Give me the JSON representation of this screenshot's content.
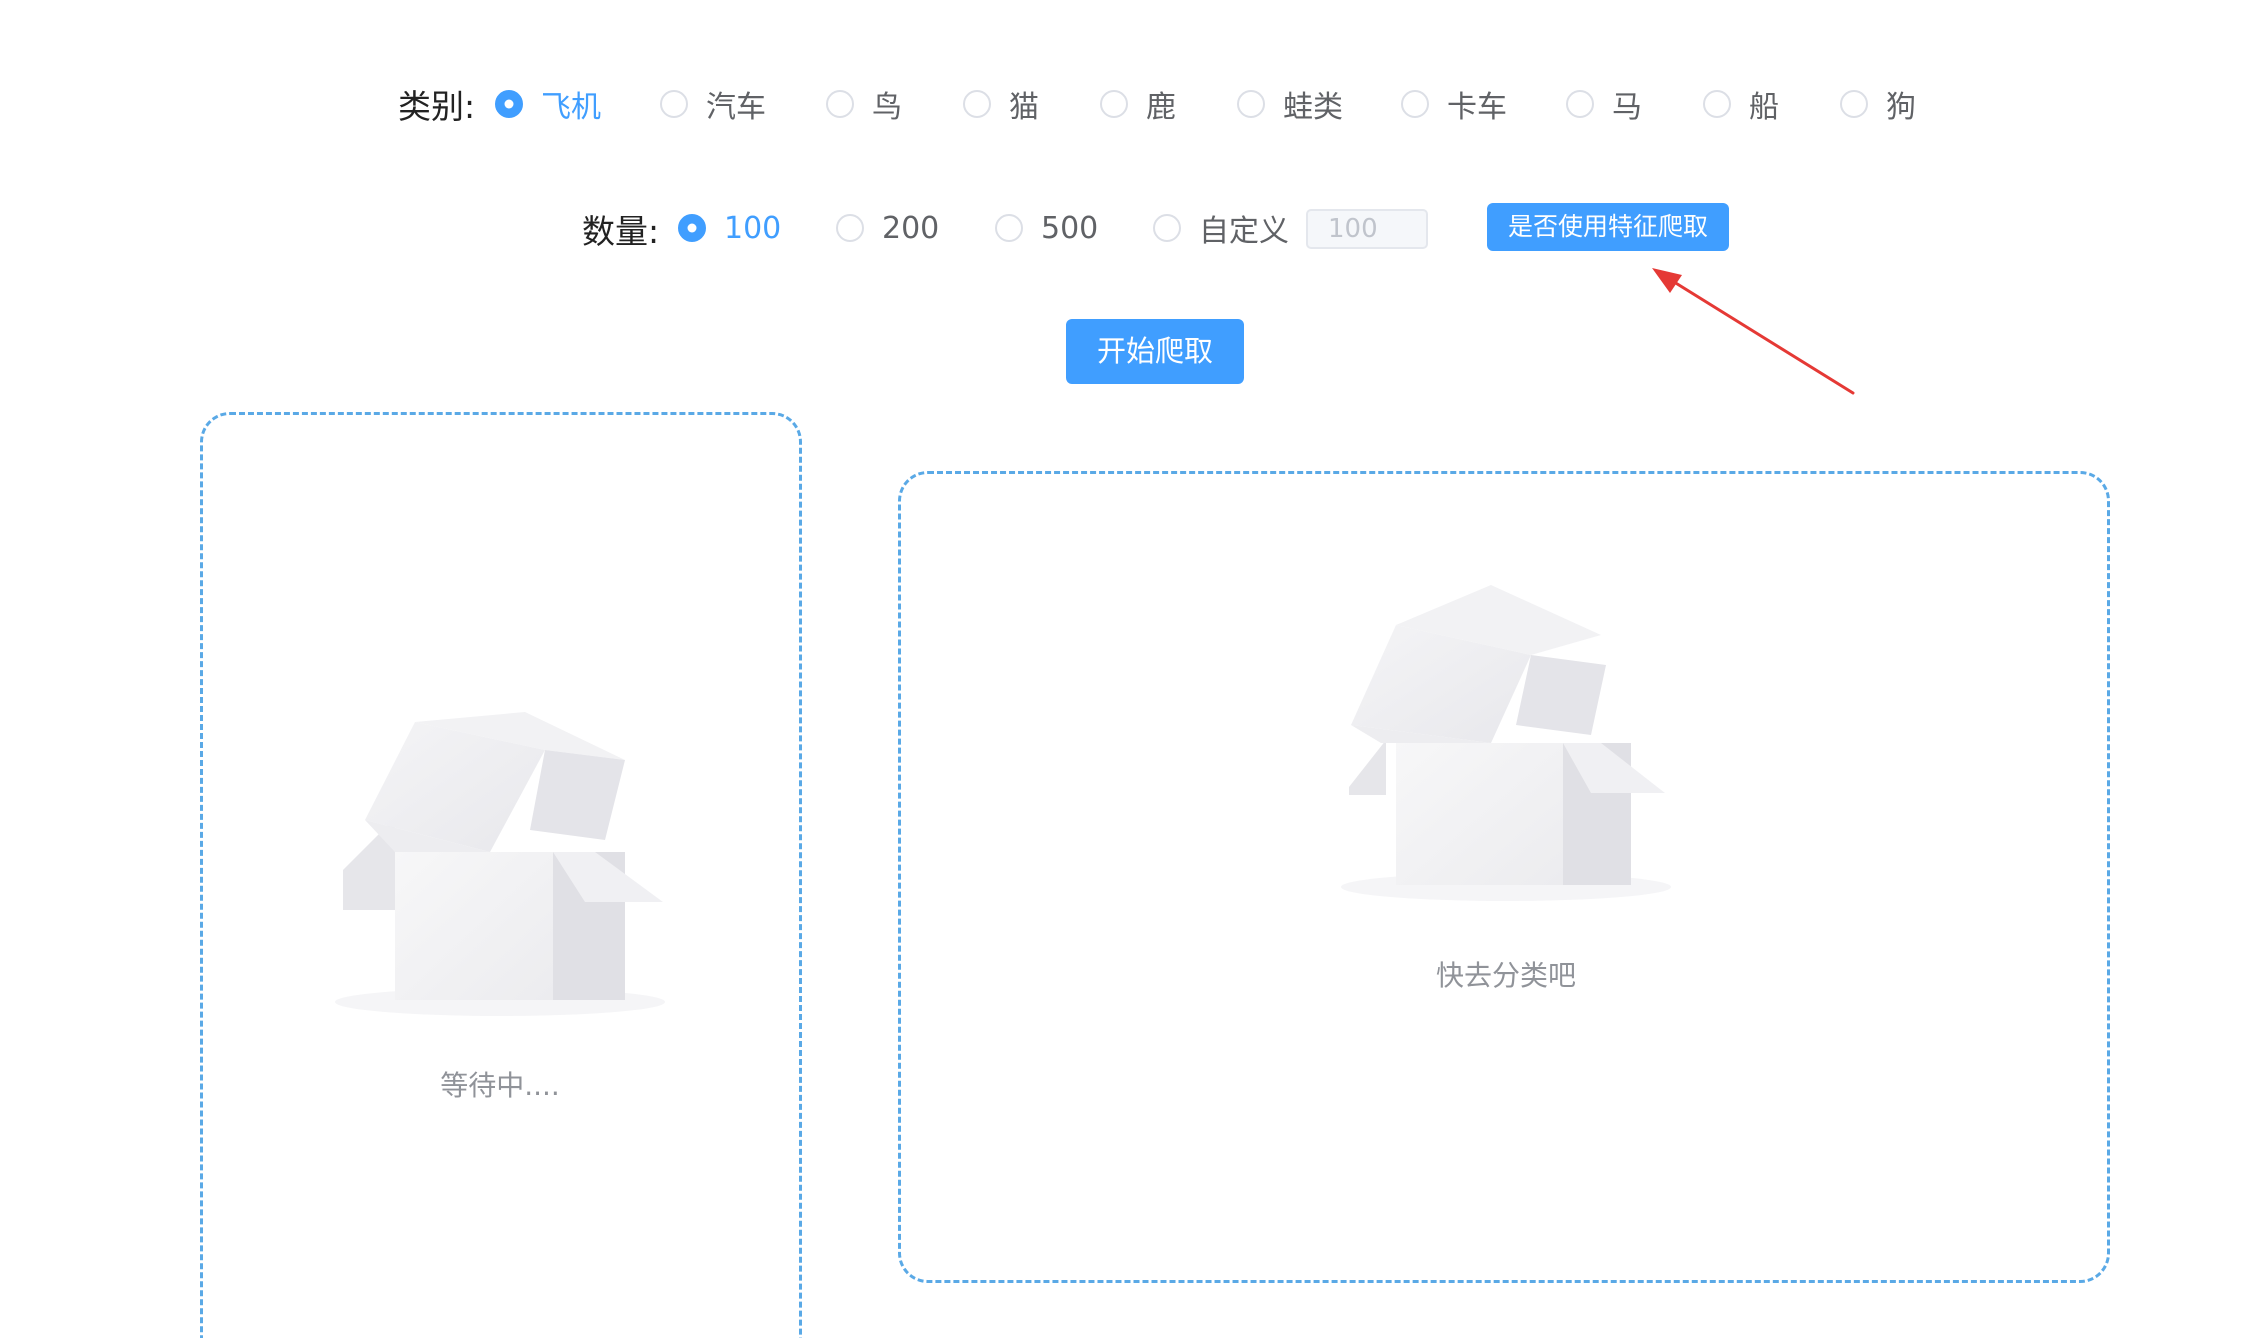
{
  "category": {
    "label": "类别:",
    "options": [
      "飞机",
      "汽车",
      "鸟",
      "猫",
      "鹿",
      "蛙类",
      "卡车",
      "马",
      "船",
      "狗"
    ],
    "selected": "飞机"
  },
  "quantity": {
    "label": "数量:",
    "options": [
      "100",
      "200",
      "500",
      "自定义"
    ],
    "selected": "100",
    "custom_placeholder": "100"
  },
  "buttons": {
    "feature_label": "是否使用特征爬取",
    "start_label": "开始爬取"
  },
  "panels": {
    "left_text": "等待中....",
    "right_text": "快去分类吧"
  },
  "colors": {
    "primary": "#409eff",
    "panel_border": "#5aa9e6",
    "arrow": "#e53935"
  },
  "icons": {
    "empty_state": "empty-box-icon",
    "annotation": "red-arrow-icon"
  }
}
